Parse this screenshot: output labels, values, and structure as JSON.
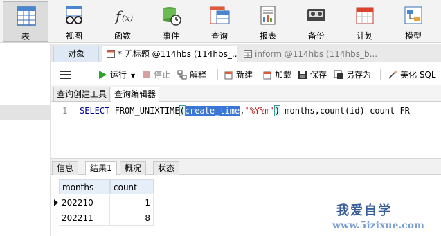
{
  "ribbon": {
    "items": [
      {
        "label": "表",
        "icon": "table-icon",
        "active": true
      },
      {
        "label": "视图",
        "icon": "view-glasses-icon"
      },
      {
        "label": "函数",
        "icon": "function-fx-icon"
      },
      {
        "label": "事件",
        "icon": "event-clock-icon"
      },
      {
        "label": "查询",
        "icon": "query-table-icon"
      },
      {
        "label": "报表",
        "icon": "report-document-icon"
      },
      {
        "label": "备份",
        "icon": "backup-tape-icon"
      },
      {
        "label": "计划",
        "icon": "calendar-icon"
      },
      {
        "label": "模型",
        "icon": "model-icon"
      }
    ]
  },
  "tabs": {
    "objects_label": "对象",
    "current_tab": "* 无标题 @114hbs (114hbs_...",
    "other_tab": "inform @114hbs (114hbs_b..."
  },
  "actions": {
    "run": "运行",
    "stop": "停止",
    "explain": "解释",
    "new": "新建",
    "load": "加载",
    "save": "保存",
    "save_as": "另存为",
    "beautify": "美化 SQL"
  },
  "subtabs": {
    "builder": "查询创建工具",
    "editor": "查询编辑器"
  },
  "editor": {
    "line_number": "1",
    "code": {
      "kw_select": "SELECT",
      "fn_part": " FROM_UNIXTIME",
      "lparen": "(",
      "selected": "create_time",
      "comma": ",",
      "string": "'%Y%m'",
      "rparen": ")",
      "rest": " months,count(id) count FR"
    }
  },
  "result_tabs": {
    "info": "信息",
    "result1": "结果1",
    "overview": "概况",
    "status": "状态"
  },
  "grid": {
    "columns": [
      "months",
      "count"
    ],
    "rows": [
      {
        "months": "202210",
        "count": "1"
      },
      {
        "months": "202211",
        "count": "8"
      }
    ]
  },
  "watermark": {
    "title": "我爱自学",
    "url": "www.5izixue.com"
  },
  "colors": {
    "selection": "#3976d6",
    "header_bg": "#e6eef8",
    "run_green": "#2aa52a"
  }
}
